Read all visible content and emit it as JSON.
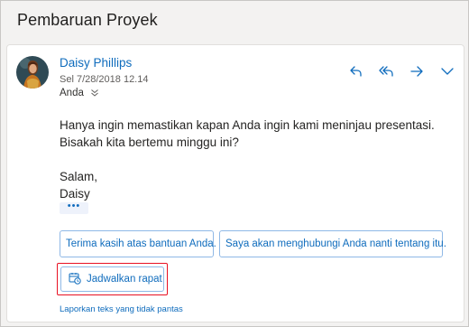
{
  "subject": "Pembaruan Proyek",
  "sender": {
    "name": "Daisy Phillips",
    "date": "Sel 7/28/2018 12.14"
  },
  "recipient": "Anda",
  "actions": [
    {
      "name": "reply-icon"
    },
    {
      "name": "reply-all-icon"
    },
    {
      "name": "forward-icon"
    },
    {
      "name": "chevron-down-icon"
    }
  ],
  "body": {
    "line1": "Hanya ingin memastikan kapan Anda ingin kami meninjau presentasi.",
    "line2": "Bisakah kita bertemu minggu ini?",
    "closing": "Salam,",
    "signature": "Daisy"
  },
  "more_label": "•••",
  "suggested_replies": [
    "Terima kasih atas bantuan Anda.",
    "Saya akan menghubungi Anda nanti tentang itu."
  ],
  "schedule_action": {
    "label": "Jadwalkan rapat",
    "icon": "calendar-clock-icon"
  },
  "report_link": "Laporkan teks yang tidak pantas",
  "colors": {
    "accent": "#0f6cbd",
    "highlight": "#e81123",
    "card_bg": "#ffffff",
    "page_bg": "#f3f2f1"
  }
}
